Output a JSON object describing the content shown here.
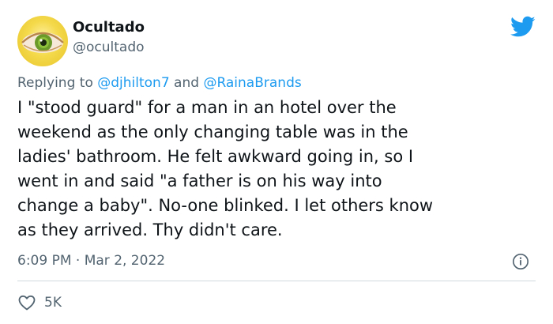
{
  "user": {
    "display_name": "Ocultado",
    "handle": "@ocultado",
    "avatar_icon": "green-eye-avatar"
  },
  "reply": {
    "prefix": "Replying to ",
    "mention_1": "@djhilton7",
    "conjunction": " and ",
    "mention_2": "@RainaBrands"
  },
  "tweet": {
    "text": "I \"stood guard\" for a man in an hotel over the\nweekend as the only changing table was in the\nladies' bathroom.  He felt awkward going in,  so I\nwent in and said \"a father is on his way into\nchange a baby\". No-one blinked.  I let others know\nas they arrived.  Thy didn't care.",
    "timestamp": "6:09 PM · Mar 2, 2022"
  },
  "stats": {
    "likes": "5K"
  },
  "colors": {
    "twitter_blue": "#1d9bf0",
    "text_primary": "#0f1419",
    "text_secondary": "#536471",
    "divider": "#cfd9de"
  },
  "icons": {
    "brand": "twitter-bird-icon",
    "info": "info-icon",
    "like": "heart-icon"
  }
}
